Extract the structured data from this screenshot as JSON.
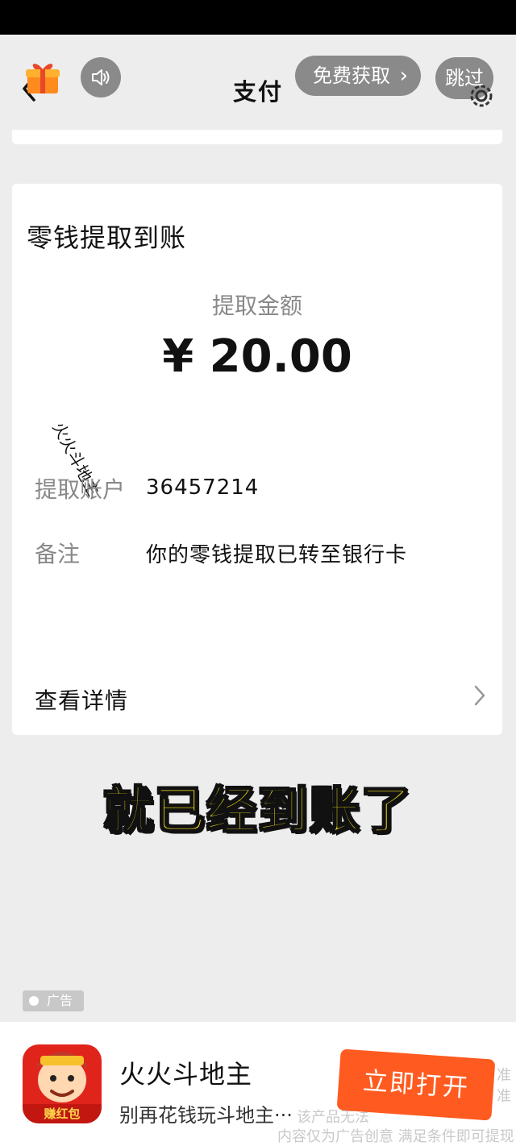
{
  "header": {
    "title": "支付",
    "free_button": "免费获取",
    "skip_button": "跳过"
  },
  "card": {
    "title": "零钱提取到账",
    "amount_label": "提取金额",
    "amount_value": "¥ 20.00",
    "watermark": "火火斗地主",
    "rows": [
      {
        "label": "提取账户",
        "value": "36457214"
      },
      {
        "label": "备注",
        "value": "你的零钱提取已转至银行卡"
      }
    ],
    "details_label": "查看详情"
  },
  "caption": "就已经到账了",
  "ad": {
    "tag": "广告",
    "app_name": "火火斗地主",
    "app_desc": "别再花钱玩斗地主···",
    "icon_badge": "赚红包",
    "open_button": "立即打开",
    "fine_print": [
      "准",
      "准",
      "该产品无法",
      "内容仅为广告创意 满足条件即可提现"
    ]
  },
  "colors": {
    "caption_text": "#f5e21b",
    "open_button_bg": "#ff5a1f",
    "header_pill_bg": "#8a8a8a"
  }
}
